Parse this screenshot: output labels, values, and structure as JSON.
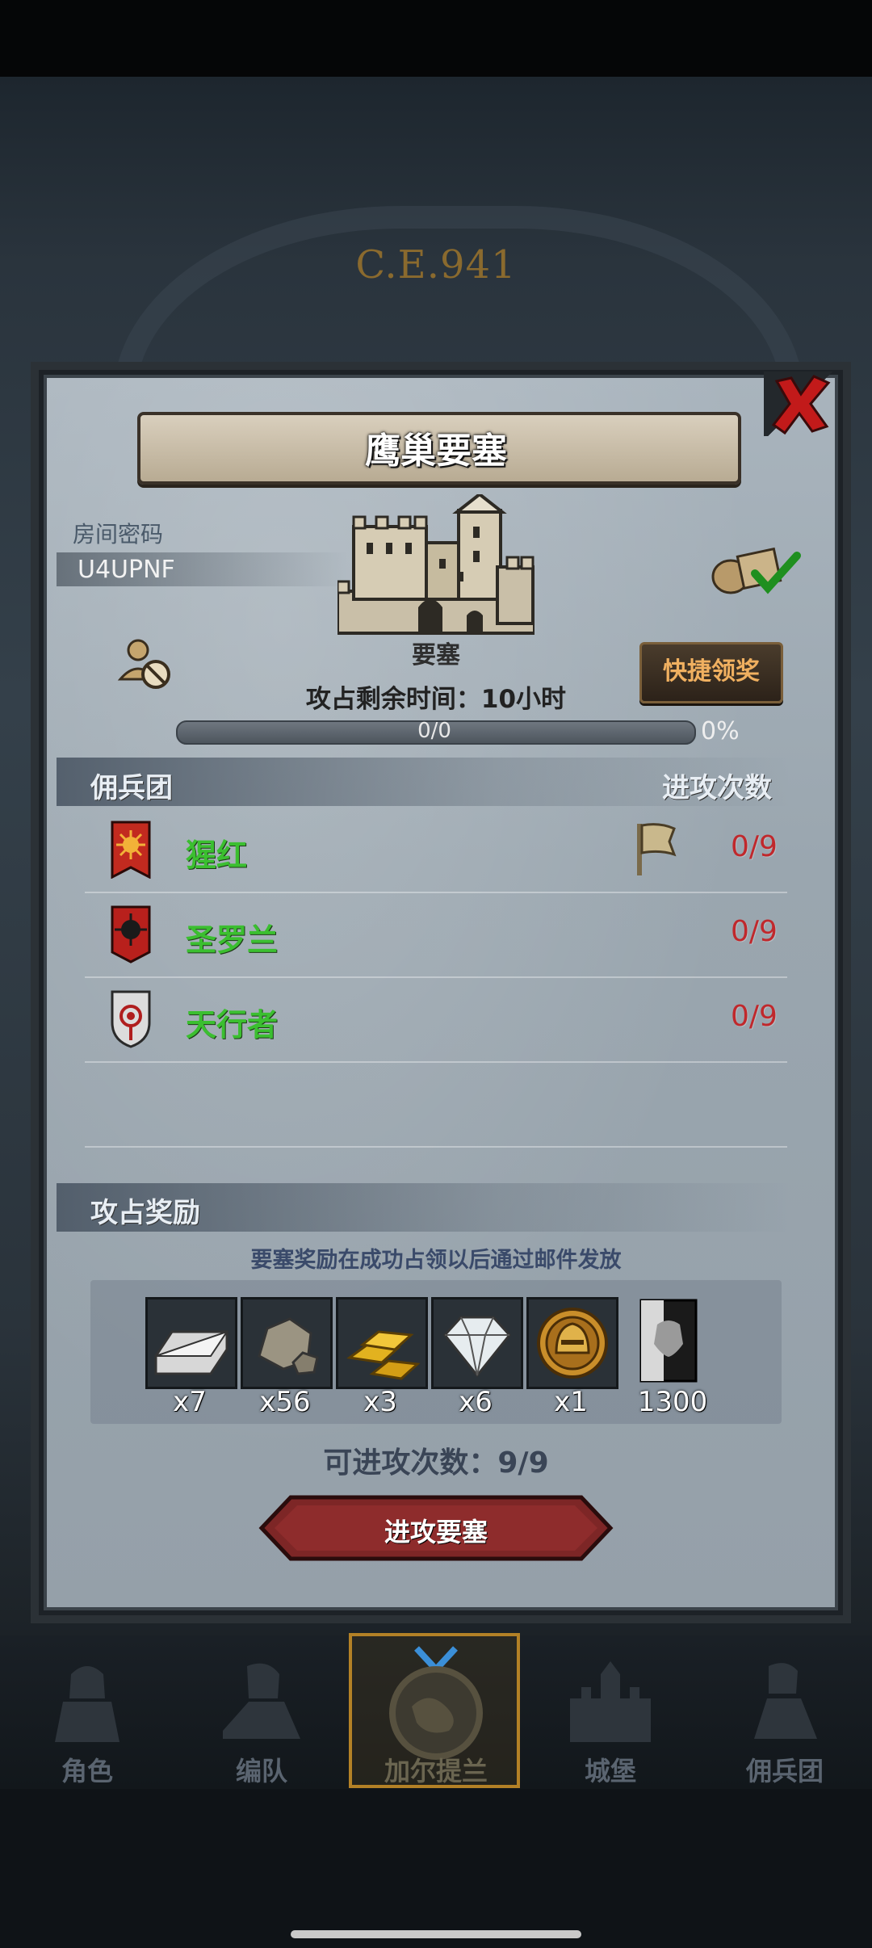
{
  "era": "C.E.941",
  "dialog": {
    "title": "鹰巢要塞",
    "room_code_label": "房间密码",
    "room_code": "U4UPNF",
    "castle_label": "要塞",
    "quick_claim_label": "快捷领奖",
    "occupy_time_label": "攻占剩余时间：",
    "occupy_time_value": "10小时",
    "progress_count": "0/0",
    "progress_percent": "0%",
    "progress_fraction": 0
  },
  "mercenary": {
    "header_left": "佣兵团",
    "header_right": "进攻次数",
    "rows": [
      {
        "name": "猩红",
        "count": "0/9",
        "banner_color": "#c22a1f",
        "has_flag": true
      },
      {
        "name": "圣罗兰",
        "count": "0/9",
        "banner_color": "#b8201c",
        "has_flag": false
      },
      {
        "name": "天行者",
        "count": "0/9",
        "banner_color": "#d8d8d8",
        "has_flag": false
      }
    ]
  },
  "rewards": {
    "header": "攻占奖励",
    "note": "要塞奖励在成功占领以后通过邮件发放",
    "items": [
      {
        "icon": "silver-ingot-icon",
        "qty": "x7"
      },
      {
        "icon": "stone-icon",
        "qty": "x56"
      },
      {
        "icon": "gold-bars-icon",
        "qty": "x3"
      },
      {
        "icon": "diamond-icon",
        "qty": "x6"
      },
      {
        "icon": "helmet-medal-icon",
        "qty": "x1"
      },
      {
        "icon": "honor-banner-icon",
        "qty": "1300"
      }
    ]
  },
  "attack": {
    "count_label": "可进攻次数：9/9",
    "button_label": "进攻要塞"
  },
  "nav": {
    "items": [
      {
        "label": "角色",
        "icon": "knight-icon"
      },
      {
        "label": "编队",
        "icon": "squad-icon"
      },
      {
        "label": "加尔提兰",
        "icon": "world-map-icon"
      },
      {
        "label": "城堡",
        "icon": "castle-icon"
      },
      {
        "label": "佣兵团",
        "icon": "mercenary-icon"
      }
    ],
    "selected_index": 2
  },
  "colors": {
    "accent_gold": "#b38126",
    "merc_green": "#3bbf30",
    "count_red": "#c0282c"
  }
}
